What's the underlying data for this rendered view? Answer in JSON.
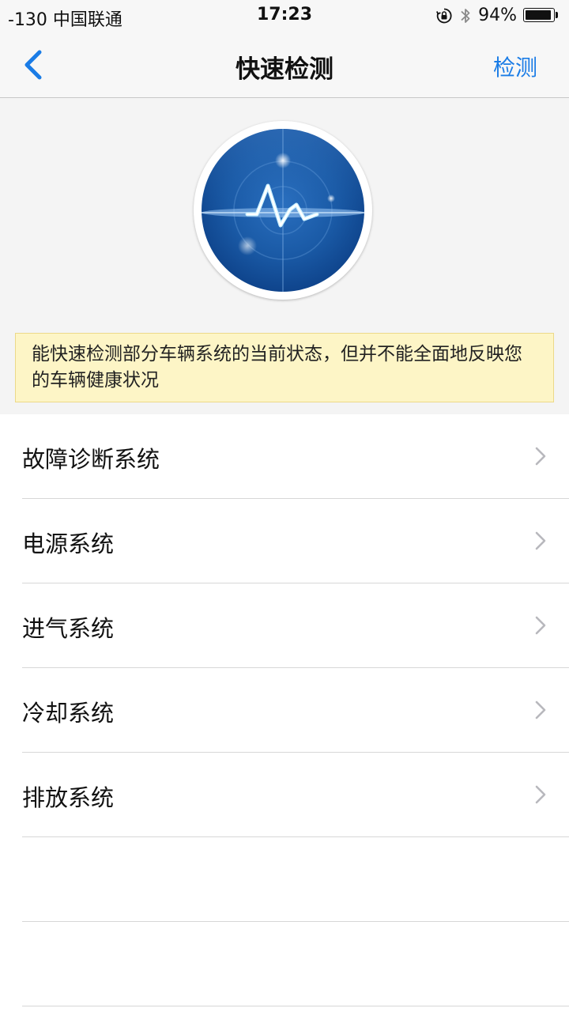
{
  "status_bar": {
    "carrier": "-130 中国联通",
    "time": "17:23",
    "battery_percent": "94%",
    "battery_level": 0.94,
    "icons": [
      "rotation-lock-icon",
      "bluetooth-icon",
      "battery-icon"
    ]
  },
  "nav": {
    "title": "快速检测",
    "action_label": "检测",
    "back_icon": "chevron-left-icon",
    "accent_color": "#1a7ce6"
  },
  "hero": {
    "icon": "radar-heartbeat-icon"
  },
  "notice": {
    "text": "能快速检测部分车辆系统的当前状态，但并不能全面地反映您的车辆健康状况"
  },
  "systems": [
    {
      "label": "故障诊断系统"
    },
    {
      "label": "电源系统"
    },
    {
      "label": "进气系统"
    },
    {
      "label": "冷却系统"
    },
    {
      "label": "排放系统"
    }
  ]
}
